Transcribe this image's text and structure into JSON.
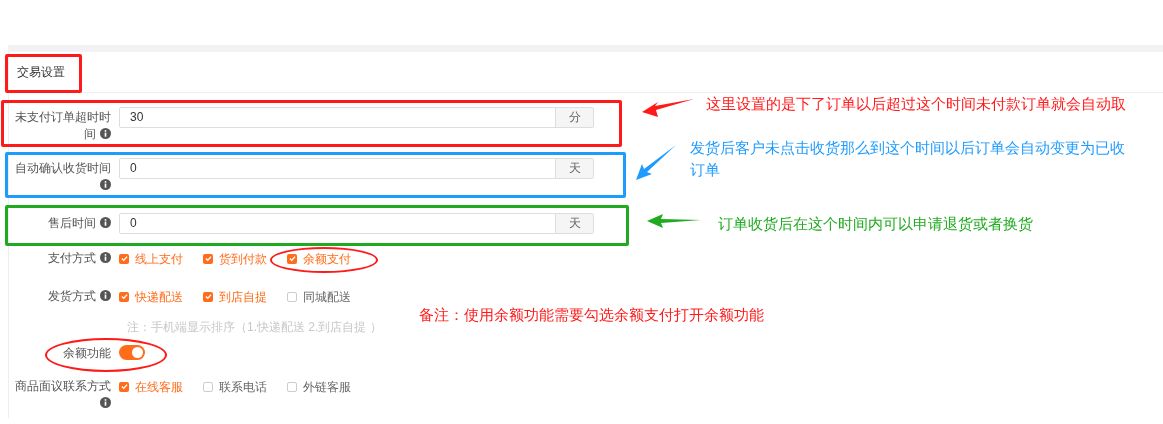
{
  "section_title": "交易设置",
  "fields": [
    {
      "label": "未支付订单超时时间",
      "value": "30",
      "unit": "分"
    },
    {
      "label": "自动确认收货时间",
      "value": "0",
      "unit": "天"
    },
    {
      "label": "售后时间",
      "value": "0",
      "unit": "天"
    }
  ],
  "payment": {
    "label": "支付方式",
    "options": [
      {
        "label": "线上支付",
        "checked": true
      },
      {
        "label": "货到付款",
        "checked": true
      },
      {
        "label": "余额支付",
        "checked": true
      }
    ]
  },
  "shipping": {
    "label": "发货方式",
    "options": [
      {
        "label": "快递配送",
        "checked": true
      },
      {
        "label": "到店自提",
        "checked": true
      },
      {
        "label": "同城配送",
        "checked": false
      }
    ],
    "note": "注：手机端显示排序（1.快递配送 2.到店自提 ）"
  },
  "balance": {
    "label": "余额功能",
    "on": true
  },
  "contact": {
    "label": "商品面议联系方式",
    "options": [
      {
        "label": "在线客服",
        "checked": true
      },
      {
        "label": "联系电话",
        "checked": false
      },
      {
        "label": "外链客服",
        "checked": false
      }
    ]
  },
  "annotations": [
    {
      "kind": "box",
      "color": "#ff1a1a"
    },
    {
      "kind": "box",
      "color": "#ff1a1a"
    },
    {
      "kind": "box",
      "color": "#1e9bff"
    },
    {
      "kind": "box",
      "color": "#1faa1f"
    },
    {
      "kind": "ellipse",
      "color": "#ff1a1a"
    },
    {
      "kind": "ellipse",
      "color": "#ff1a1a"
    },
    {
      "kind": "arrow",
      "color": "#ff1a1a"
    },
    {
      "kind": "arrow",
      "color": "#1e9bff"
    },
    {
      "kind": "arrow",
      "color": "#1faa1f"
    },
    {
      "kind": "text",
      "color": "#ff1a1a",
      "lines": [
        "这里设置的是下了订单以后超过这个时间未付款订单就会自动取"
      ]
    },
    {
      "kind": "text",
      "color": "#1e9bff",
      "lines": [
        "发货后客户未点击收货那么到这个时间以后订单会自动变更为已收",
        "订单"
      ]
    },
    {
      "kind": "text",
      "color": "#1faa1f",
      "lines": [
        "订单收货后在这个时间内可以申请退货或者换货"
      ]
    },
    {
      "kind": "text",
      "color": "#ff1a1a",
      "lines": [
        "备注：使用余额功能需要勾选余额支付打开余额功能"
      ]
    }
  ]
}
